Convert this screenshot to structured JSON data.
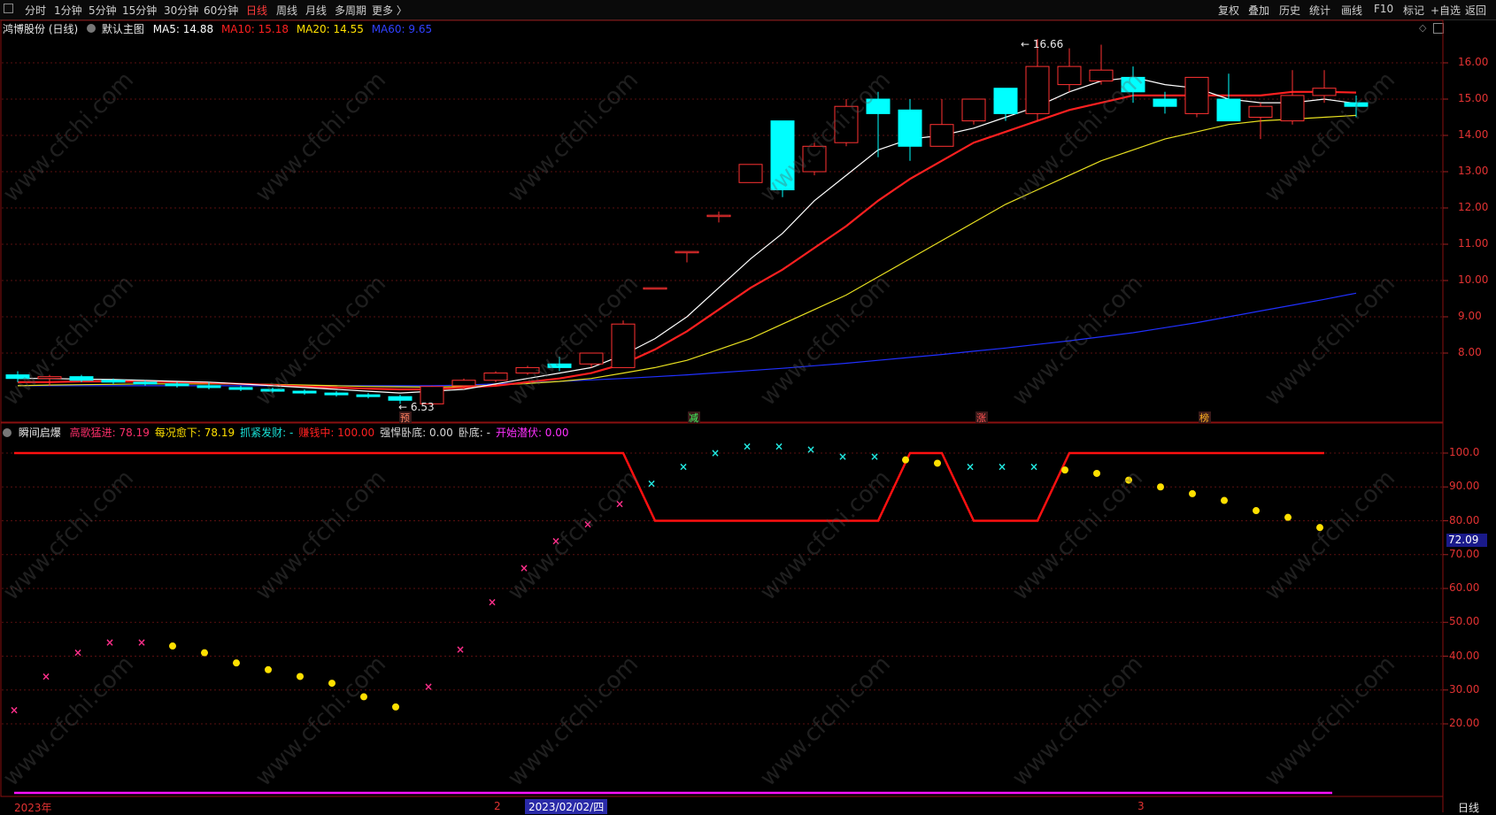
{
  "toolbar": {
    "icon": "grid-icon",
    "tabs": [
      "分时",
      "1分钟",
      "5分钟",
      "15分钟",
      "30分钟",
      "60分钟",
      "日线",
      "周线",
      "月线",
      "多周期",
      "更多 〉"
    ],
    "active_tab": "日线",
    "right_buttons": [
      "复权",
      "叠加",
      "历史",
      "统计",
      "画线",
      "F10",
      "标记",
      "+自选",
      "返回"
    ]
  },
  "main_chart": {
    "stock_name": "鸿博股份 (日线)",
    "theme_label": "默认主图",
    "ma5": "MA5: 14.88",
    "ma10": "MA10: 15.18",
    "ma20": "MA20: 14.55",
    "ma60": "MA60: 9.65",
    "high_marker": "16.66",
    "low_marker": "6.53",
    "signal_labels": [
      "预",
      "减",
      "涨",
      "榜"
    ],
    "price_ticks": [
      "16.00",
      "15.00",
      "14.00",
      "13.00",
      "12.00",
      "11.00",
      "10.00",
      "9.00",
      "8.00"
    ]
  },
  "indicator": {
    "name": "瞬间启爆",
    "fields": [
      {
        "label": "高歌猛进: 78.19",
        "color": "#ff2f6b"
      },
      {
        "label": "每况愈下: 78.19",
        "color": "#ffe000"
      },
      {
        "label": "抓紧发财: -",
        "color": "#19e0d6"
      },
      {
        "label": "赚钱中: 100.00",
        "color": "#ff2020"
      },
      {
        "label": "强悍卧底: 0.00",
        "color": "#d8d8d8"
      },
      {
        "label": "卧底: -",
        "color": "#d8d8d8"
      },
      {
        "label": "开始潜伏: 0.00",
        "color": "#ff30ff"
      }
    ],
    "axis_ticks": [
      "100.0",
      "90.00",
      "80.00",
      "70.00",
      "60.00",
      "50.00",
      "40.00",
      "30.00",
      "20.00"
    ],
    "current_value": "72.09"
  },
  "bottom": {
    "year_label": "2023年",
    "month_2": "2",
    "cursor_date": "2023/02/02/四",
    "month_3": "3",
    "period_label": "日线"
  },
  "watermark": "www.cfchi.com",
  "colors": {
    "up": "#ff3232",
    "down": "#00ffff",
    "ma5": "#ffffff",
    "ma10": "#ff2020",
    "ma20": "#e8e020",
    "ma60": "#2030ff",
    "pink": "#ff2f8a",
    "yellow": "#ffe000",
    "cyan": "#22e8e0",
    "magenta": "#ff10ff"
  },
  "chart_data": {
    "type": "candlestick",
    "ohlc": [
      [
        7.4,
        7.5,
        7.2,
        7.3
      ],
      [
        7.3,
        7.4,
        7.1,
        7.35
      ],
      [
        7.35,
        7.4,
        7.2,
        7.25
      ],
      [
        7.25,
        7.3,
        7.15,
        7.2
      ],
      [
        7.2,
        7.25,
        7.1,
        7.15
      ],
      [
        7.15,
        7.2,
        7.05,
        7.1
      ],
      [
        7.1,
        7.2,
        7.0,
        7.05
      ],
      [
        7.05,
        7.1,
        6.95,
        7.0
      ],
      [
        7.0,
        7.05,
        6.9,
        6.95
      ],
      [
        6.95,
        7.0,
        6.85,
        6.9
      ],
      [
        6.9,
        6.95,
        6.8,
        6.85
      ],
      [
        6.85,
        6.9,
        6.75,
        6.8
      ],
      [
        6.8,
        6.85,
        6.6,
        6.7
      ],
      [
        6.6,
        7.1,
        6.53,
        7.08
      ],
      [
        7.1,
        7.3,
        7.0,
        7.25
      ],
      [
        7.25,
        7.5,
        7.2,
        7.45
      ],
      [
        7.45,
        7.65,
        7.4,
        7.6
      ],
      [
        7.7,
        7.9,
        7.5,
        7.6
      ],
      [
        7.7,
        8.0,
        7.6,
        8.0
      ],
      [
        7.6,
        8.9,
        7.6,
        8.8
      ],
      [
        9.8,
        9.8,
        9.8,
        9.8
      ],
      [
        10.8,
        10.8,
        10.5,
        10.8
      ],
      [
        11.8,
        11.9,
        11.6,
        11.8
      ],
      [
        12.7,
        13.2,
        12.7,
        13.2
      ],
      [
        14.4,
        14.4,
        12.3,
        12.5
      ],
      [
        13.0,
        13.8,
        12.9,
        13.7
      ],
      [
        13.8,
        15.0,
        13.7,
        14.8
      ],
      [
        15.0,
        15.2,
        13.4,
        14.6
      ],
      [
        14.7,
        15.0,
        13.3,
        13.7
      ],
      [
        13.7,
        15.0,
        13.7,
        14.3
      ],
      [
        14.4,
        15.0,
        14.3,
        15.0
      ],
      [
        15.3,
        15.3,
        14.4,
        14.6
      ],
      [
        14.6,
        16.66,
        14.4,
        15.9
      ],
      [
        15.4,
        16.4,
        15.2,
        15.9
      ],
      [
        15.5,
        16.5,
        15.4,
        15.8
      ],
      [
        15.6,
        15.9,
        14.9,
        15.2
      ],
      [
        15.0,
        15.2,
        14.6,
        14.8
      ],
      [
        14.6,
        15.6,
        14.5,
        15.6
      ],
      [
        15.0,
        15.7,
        14.5,
        14.4
      ],
      [
        14.5,
        14.9,
        13.9,
        14.8
      ],
      [
        14.4,
        15.8,
        14.3,
        15.1
      ],
      [
        15.1,
        15.8,
        14.9,
        15.3
      ],
      [
        14.9,
        15.1,
        14.5,
        14.8
      ]
    ],
    "ma5": [
      7.3,
      7.3,
      7.28,
      7.27,
      7.25,
      7.22,
      7.2,
      7.15,
      7.1,
      7.05,
      7.0,
      6.95,
      6.9,
      6.95,
      7.0,
      7.15,
      7.3,
      7.45,
      7.6,
      7.95,
      8.4,
      9.0,
      9.8,
      10.6,
      11.3,
      12.2,
      12.9,
      13.6,
      13.9,
      14.0,
      14.2,
      14.5,
      14.8,
      15.2,
      15.5,
      15.6,
      15.4,
      15.3,
      15.0,
      14.9,
      14.9,
      15.0,
      14.88
    ],
    "ma10": [
      7.2,
      7.2,
      7.22,
      7.22,
      7.21,
      7.2,
      7.18,
      7.15,
      7.12,
      7.08,
      7.05,
      7.02,
      7.0,
      7.0,
      7.05,
      7.1,
      7.2,
      7.3,
      7.45,
      7.7,
      8.1,
      8.6,
      9.2,
      9.8,
      10.3,
      10.9,
      11.5,
      12.2,
      12.8,
      13.3,
      13.8,
      14.1,
      14.4,
      14.7,
      14.9,
      15.1,
      15.1,
      15.1,
      15.1,
      15.1,
      15.2,
      15.2,
      15.18
    ],
    "ma20": [
      7.1,
      7.12,
      7.13,
      7.14,
      7.15,
      7.15,
      7.15,
      7.15,
      7.14,
      7.12,
      7.1,
      7.08,
      7.07,
      7.06,
      7.08,
      7.12,
      7.16,
      7.22,
      7.3,
      7.45,
      7.6,
      7.8,
      8.1,
      8.4,
      8.8,
      9.2,
      9.6,
      10.1,
      10.6,
      11.1,
      11.6,
      12.1,
      12.5,
      12.9,
      13.3,
      13.6,
      13.9,
      14.1,
      14.3,
      14.4,
      14.45,
      14.5,
      14.55
    ],
    "ma60": [
      7.1,
      7.1,
      7.1,
      7.1,
      7.1,
      7.1,
      7.1,
      7.1,
      7.1,
      7.1,
      7.1,
      7.1,
      7.1,
      7.1,
      7.12,
      7.15,
      7.18,
      7.22,
      7.26,
      7.3,
      7.35,
      7.4,
      7.46,
      7.52,
      7.58,
      7.65,
      7.72,
      7.8,
      7.88,
      7.96,
      8.05,
      8.14,
      8.24,
      8.34,
      8.45,
      8.56,
      8.7,
      8.84,
      9.0,
      9.16,
      9.32,
      9.48,
      9.65
    ],
    "indicator_points": [
      [
        24,
        "pink"
      ],
      [
        34,
        "pink"
      ],
      [
        41,
        "pink"
      ],
      [
        44,
        "pink"
      ],
      [
        44,
        "pink"
      ],
      [
        43,
        "yellow"
      ],
      [
        41,
        "yellow"
      ],
      [
        38,
        "yellow"
      ],
      [
        36,
        "yellow"
      ],
      [
        34,
        "yellow"
      ],
      [
        32,
        "yellow"
      ],
      [
        28,
        "yellow"
      ],
      [
        25,
        "yellow"
      ],
      [
        31,
        "pink"
      ],
      [
        42,
        "pink"
      ],
      [
        56,
        "pink"
      ],
      [
        66,
        "pink"
      ],
      [
        74,
        "pink"
      ],
      [
        79,
        "pink"
      ],
      [
        85,
        "pink"
      ],
      [
        91,
        "cyan"
      ],
      [
        96,
        "cyan"
      ],
      [
        100,
        "cyan"
      ],
      [
        102,
        "cyan"
      ],
      [
        102,
        "cyan"
      ],
      [
        101,
        "cyan"
      ],
      [
        99,
        "cyan"
      ],
      [
        99,
        "cyan"
      ],
      [
        98,
        "yellow"
      ],
      [
        97,
        "yellow"
      ],
      [
        96,
        "cyan"
      ],
      [
        96,
        "cyan"
      ],
      [
        96,
        "cyan"
      ],
      [
        95,
        "yellow"
      ],
      [
        94,
        "yellow"
      ],
      [
        92,
        "yellow"
      ],
      [
        90,
        "yellow"
      ],
      [
        88,
        "yellow"
      ],
      [
        86,
        "yellow"
      ],
      [
        83,
        "yellow"
      ],
      [
        81,
        "yellow"
      ],
      [
        78,
        "yellow"
      ]
    ],
    "red_line": [
      [
        0,
        100
      ],
      [
        19,
        100
      ],
      [
        20,
        80
      ],
      [
        27,
        80
      ],
      [
        28,
        100
      ],
      [
        29,
        100
      ],
      [
        30,
        80
      ],
      [
        32,
        80
      ],
      [
        33,
        100
      ],
      [
        41,
        100
      ]
    ]
  }
}
